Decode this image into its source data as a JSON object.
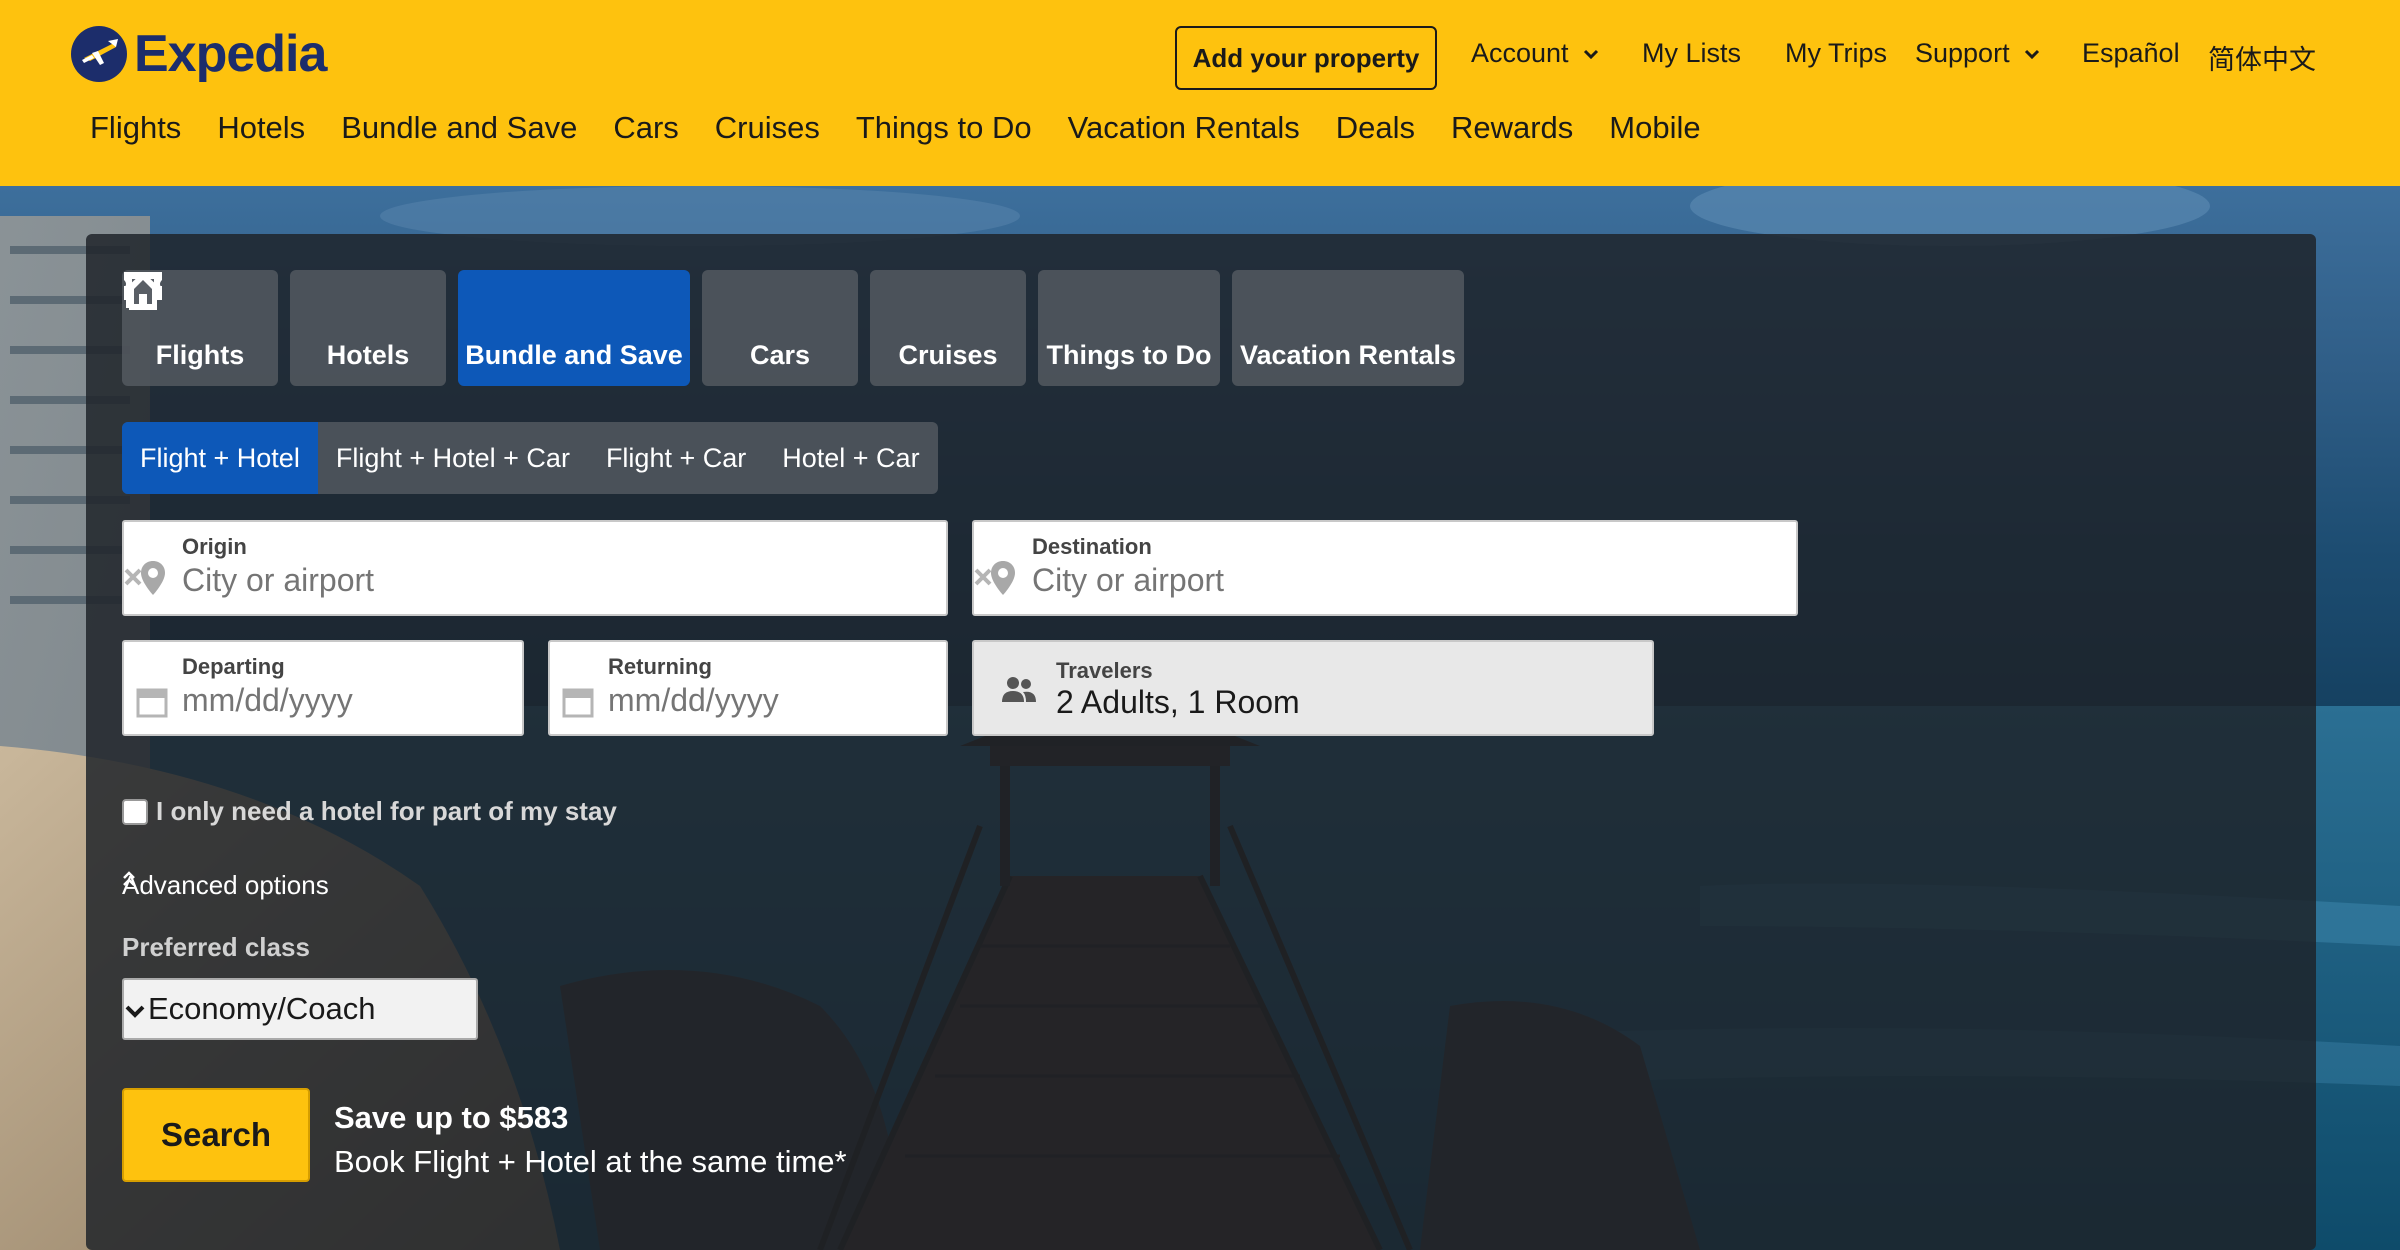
{
  "brand": {
    "name": "Expedia",
    "color": "#fec20e",
    "accent": "#0d58b8",
    "logo_color": "#1c2d6b"
  },
  "header": {
    "add_property": "Add your property",
    "account": "Account",
    "my_lists": "My Lists",
    "my_trips": "My Trips",
    "support": "Support",
    "espanol": "Español",
    "chinese": "简体中文"
  },
  "nav": [
    "Flights",
    "Hotels",
    "Bundle and Save",
    "Cars",
    "Cruises",
    "Things to Do",
    "Vacation Rentals",
    "Deals",
    "Rewards",
    "Mobile"
  ],
  "lob_tabs": [
    {
      "label": "Flights",
      "icon": "plane-icon"
    },
    {
      "label": "Hotels",
      "icon": "building-icon"
    },
    {
      "label": "Bundle and Save",
      "icon": "plane-building-icon",
      "active": true
    },
    {
      "label": "Cars",
      "icon": "car-icon"
    },
    {
      "label": "Cruises",
      "icon": "ship-icon"
    },
    {
      "label": "Things to Do",
      "icon": "ticket-icon"
    },
    {
      "label": "Vacation Rentals",
      "icon": "house-icon"
    }
  ],
  "package_tabs": [
    {
      "label": "Flight + Hotel",
      "active": true
    },
    {
      "label": "Flight + Hotel + Car"
    },
    {
      "label": "Flight + Car"
    },
    {
      "label": "Hotel + Car"
    }
  ],
  "form": {
    "origin": {
      "label": "Origin",
      "placeholder": "City or airport"
    },
    "destination": {
      "label": "Destination",
      "placeholder": "City or airport"
    },
    "departing": {
      "label": "Departing",
      "placeholder": "mm/dd/yyyy"
    },
    "returning": {
      "label": "Returning",
      "placeholder": "mm/dd/yyyy"
    },
    "travelers": {
      "label": "Travelers",
      "value": "2 Adults, 1 Room"
    },
    "partial_stay": "I only need a hotel for part of my stay",
    "advanced_options": "Advanced options",
    "preferred_class_label": "Preferred class",
    "preferred_class_value": "Economy/Coach",
    "search": "Search"
  },
  "promo": {
    "headline": "Save up to $583",
    "subline": "Book Flight + Hotel at the same time*"
  }
}
